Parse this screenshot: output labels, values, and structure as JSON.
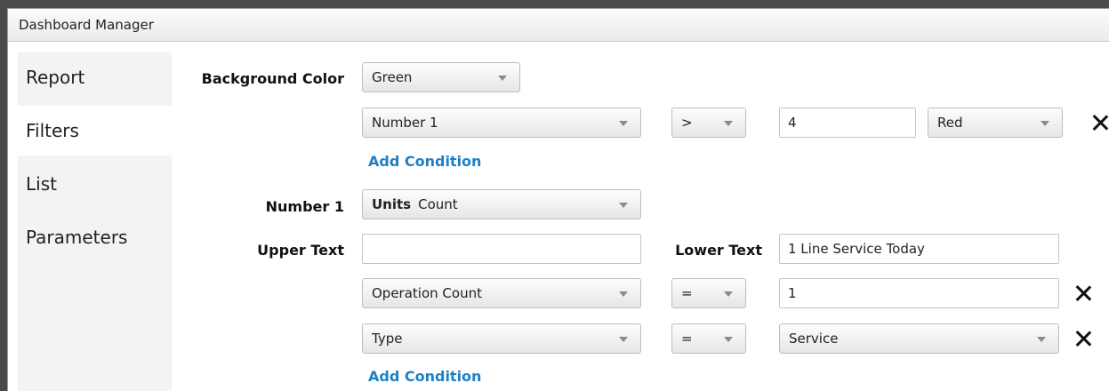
{
  "window": {
    "title": "Dashboard Manager"
  },
  "sidebar": {
    "items": [
      {
        "label": "Report",
        "active": false
      },
      {
        "label": "Filters",
        "active": true
      },
      {
        "label": "List",
        "active": false
      },
      {
        "label": "Parameters",
        "active": false
      }
    ]
  },
  "background_color": {
    "label": "Background Color",
    "value": "Green",
    "condition": {
      "field": "Number 1",
      "operator": ">",
      "value": "4",
      "color": "Red"
    },
    "add_condition": "Add Condition"
  },
  "number1": {
    "label": "Number 1",
    "units_label": "Units",
    "units_value": "Count"
  },
  "upper_text": {
    "label": "Upper Text",
    "value": ""
  },
  "lower_text": {
    "label": "Lower Text",
    "value": "1 Line Service Today"
  },
  "conditions": [
    {
      "field": "Operation Count",
      "operator": "=",
      "value": "1"
    },
    {
      "field": "Type",
      "operator": "=",
      "value": "Service"
    }
  ],
  "add_condition": "Add Condition",
  "colors": {
    "link": "#1f7fc4",
    "background": "#4a4a4a",
    "sidebar": "#f3f3f3"
  }
}
